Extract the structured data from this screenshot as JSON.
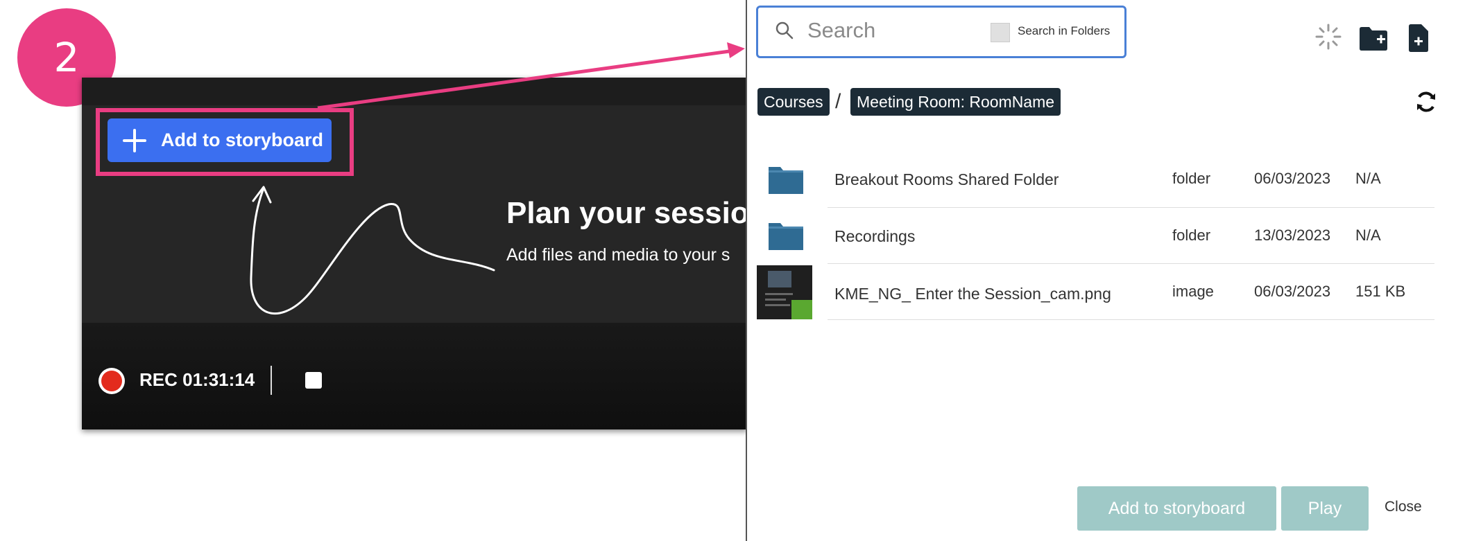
{
  "step": {
    "number": "2"
  },
  "session": {
    "add_button_label": "Add to storyboard",
    "plan_title": "Plan your sessio",
    "plan_subtitle": "Add files and media to your s",
    "rec_label": "REC 01:31:14"
  },
  "dialog": {
    "search": {
      "placeholder": "Search",
      "search_in_folders_label": "Search in Folders"
    },
    "toolbar_icons": [
      "loading-spinner-icon",
      "new-folder-icon",
      "new-file-icon"
    ],
    "breadcrumb": [
      "Courses",
      "Meeting Room: RoomName"
    ],
    "breadcrumb_separator": "/",
    "files": [
      {
        "name": "Breakout Rooms Shared Folder",
        "type": "folder",
        "date": "06/03/2023",
        "size": "N/A",
        "icon": "folder-icon"
      },
      {
        "name": "Recordings",
        "type": "folder",
        "date": "13/03/2023",
        "size": "N/A",
        "icon": "folder-icon"
      },
      {
        "name": "KME_NG_ Enter the Session_cam.png",
        "type": "image",
        "date": "06/03/2023",
        "size": "151 KB",
        "icon": "image-thumbnail"
      }
    ],
    "buttons": {
      "add_to_storyboard": "Add to storyboard",
      "play": "Play",
      "close": "Close"
    }
  },
  "colors": {
    "accent_pink": "#e93d82",
    "primary_blue": "#3b6ff0",
    "disabled_teal": "#9fc9c7",
    "folder_blue": "#2f6b93",
    "breadcrumb_bg": "#1c2b36"
  }
}
